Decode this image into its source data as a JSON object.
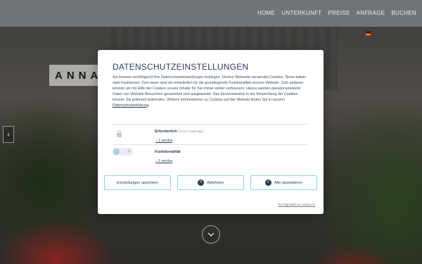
{
  "nav": {
    "items": [
      "HOME",
      "UNTERKUNFT",
      "PREISE",
      "ANFRAGE",
      "BUCHEN"
    ]
  },
  "hero": {
    "banner_text": "ANNA"
  },
  "consent": {
    "title": "DATENSCHUTZEINSTELLUNGEN",
    "body": "Sie können nachfolgend Ihre Datenschutzeinstellungen festlegen. Unsere Webseite verwendet Cookies. Diese haben zwei Funktionen: Zum einen sind sie erforderlich für die grundlegende Funktionalität unserer Website. Zum anderen können wir mit Hilfe der Cookies unsere Inhalte für Sie immer weiter verbessern. Hierzu werden pseudonymisierte Daten von Website-Besuchern gesammelt und ausgewertet. Das Einverständnis in die Verwendung der Cookies können Sie jederzeit widerrufen. Weitere Informationen zu Cookies auf der Website finden Sie in unserer",
    "privacy_link": "Datenschutzerklärung",
    "privacy_link_suffix": ".",
    "categories": [
      {
        "name": "Erforderlich",
        "note": "(immer notwendig)",
        "services": "↓ 1 service",
        "icon": "lock-icon"
      },
      {
        "name": "Funktionalität",
        "note": "",
        "services": "↓ 1 service",
        "icon": "toggle-off"
      }
    ],
    "buttons": {
      "save": "Einstellungen speichern",
      "decline": "Ablehnen",
      "accept_all": "Alle akzeptieren"
    },
    "powered_by": "Bereitgestellt von webaccht"
  },
  "colors": {
    "nav_bg": "#6f7478",
    "accent_border": "#8ed2dc",
    "primary_text": "#2c3e57"
  }
}
